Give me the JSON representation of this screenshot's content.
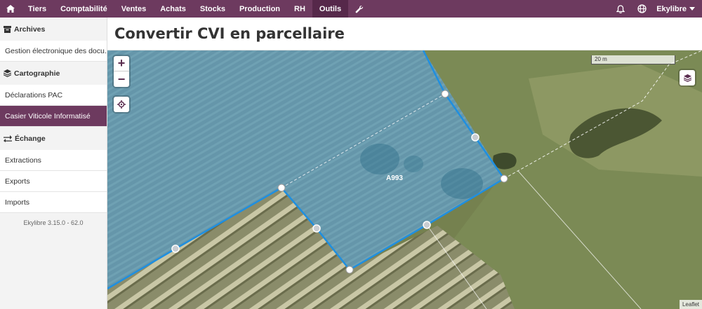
{
  "topnav": {
    "items": [
      {
        "label": "Tiers",
        "active": false
      },
      {
        "label": "Comptabilité",
        "active": false
      },
      {
        "label": "Ventes",
        "active": false
      },
      {
        "label": "Achats",
        "active": false
      },
      {
        "label": "Stocks",
        "active": false
      },
      {
        "label": "Production",
        "active": false
      },
      {
        "label": "RH",
        "active": false
      },
      {
        "label": "Outils",
        "active": true
      }
    ],
    "user": "Ekylibre",
    "icons": [
      "home-icon",
      "wrench-icon",
      "bell-icon",
      "globe-icon",
      "caret-down-icon"
    ],
    "color": "#6d3a5f"
  },
  "sidebar": {
    "sections": [
      {
        "title": "Archives",
        "icon": "archive-icon",
        "items": [
          {
            "label": "Gestion électronique des docu..."
          }
        ]
      },
      {
        "title": "Cartographie",
        "icon": "layers-icon",
        "items": [
          {
            "label": "Déclarations PAC"
          },
          {
            "label": "Casier Viticole Informatisé",
            "active": true
          }
        ]
      },
      {
        "title": "Échange",
        "icon": "exchange-icon",
        "items": [
          {
            "label": "Extractions"
          },
          {
            "label": "Exports"
          },
          {
            "label": "Imports"
          }
        ]
      }
    ],
    "version": "Ekylibre 3.15.0 - 62.0"
  },
  "page": {
    "title": "Convertir CVI en parcellaire"
  },
  "map": {
    "parcel_label": "A993",
    "scale_label": "20 m",
    "attribution": "Leaflet",
    "zoom_in": "+",
    "zoom_out": "−",
    "polygon_color": "#2f8fd8"
  }
}
